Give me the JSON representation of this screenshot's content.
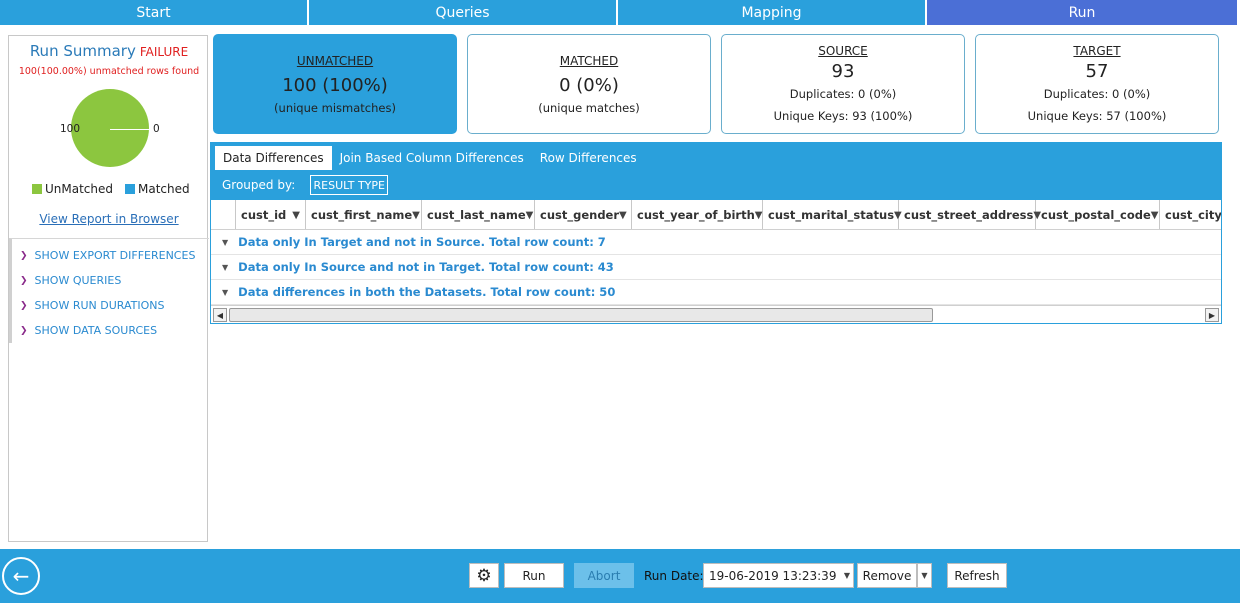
{
  "nav": {
    "tabs": [
      {
        "label": "Start"
      },
      {
        "label": "Queries"
      },
      {
        "label": "Mapping"
      },
      {
        "label": "Run"
      }
    ],
    "active_index": 3
  },
  "summary": {
    "title": "Run Summary",
    "status": "FAILURE",
    "subtitle": "100(100.00%) unmatched rows found",
    "pie_label_left": "100",
    "pie_label_right": "0",
    "unmatched_fraction": 1.0,
    "legend": {
      "unmatched": "UnMatched",
      "matched": "Matched"
    },
    "legend_colors": {
      "unmatched": "#8cc63f",
      "matched": "#2aa0dc"
    },
    "view_report": "View Report in Browser",
    "sections": [
      "SHOW EXPORT DIFFERENCES",
      "SHOW QUERIES",
      "SHOW RUN DURATIONS",
      "SHOW DATA SOURCES"
    ]
  },
  "cards": {
    "unmatched": {
      "label": "UNMATCHED",
      "value": "100 (100%)",
      "note": "(unique mismatches)"
    },
    "matched": {
      "label": "MATCHED",
      "value": "0 (0%)",
      "note": "(unique matches)"
    },
    "source": {
      "label": "SOURCE",
      "value": "93",
      "duplicates": "Duplicates:  0 (0%)",
      "unique_keys": "Unique Keys:  93 (100%)"
    },
    "target": {
      "label": "TARGET",
      "value": "57",
      "duplicates": "Duplicates:  0 (0%)",
      "unique_keys": "Unique Keys:  57 (100%)"
    }
  },
  "grid": {
    "tabs": [
      "Data Differences",
      "Join Based Column Differences",
      "Row Differences"
    ],
    "active_tab": 0,
    "grouped_by_label": "Grouped by:",
    "grouped_by_value": "RESULT TYPE",
    "columns": [
      "cust_id",
      "cust_first_name",
      "cust_last_name",
      "cust_gender",
      "cust_year_of_birth",
      "cust_marital_status",
      "cust_street_address",
      "cust_postal_code",
      "cust_city"
    ],
    "groups": [
      "Data only In Target and not in Source. Total row count: 7",
      "Data only In Source and not in Target. Total row count: 43",
      "Data differences in both the Datasets. Total row count: 50"
    ]
  },
  "toolbar": {
    "run": "Run",
    "abort": "Abort",
    "run_date_label": "Run Date:",
    "run_date_value": "19-06-2019 13:23:39",
    "remove": "Remove",
    "refresh": "Refresh"
  },
  "colors": {
    "accent": "#2aa0dc",
    "active_tab": "#4b6fd6",
    "failure": "#e02020",
    "group_text": "#2a8ad0"
  }
}
